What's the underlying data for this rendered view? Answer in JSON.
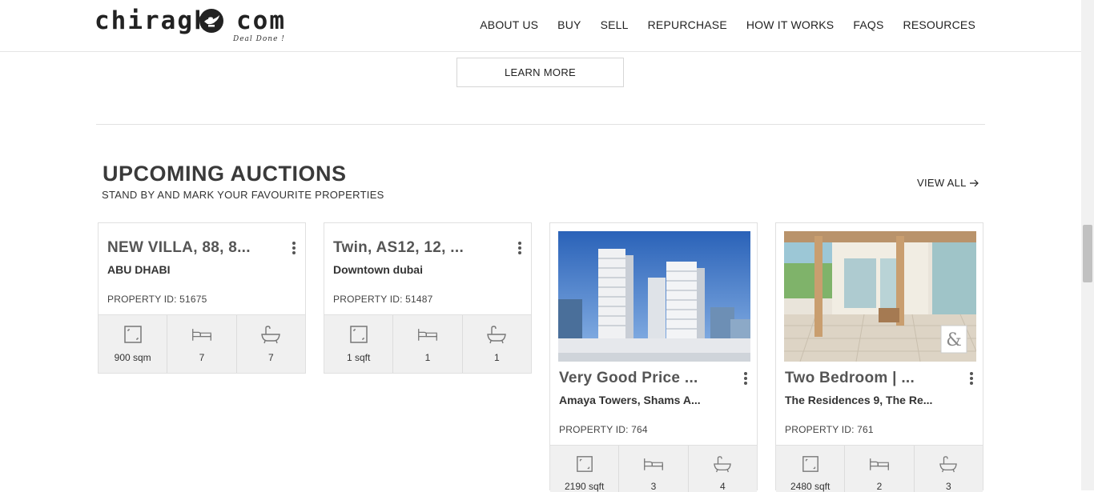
{
  "brand": {
    "left": "chiragh",
    "right": "com",
    "tagline": "Deal Done !"
  },
  "nav": [
    "ABOUT US",
    "BUY",
    "SELL",
    "REPURCHASE",
    "HOW IT WORKS",
    "FAQS",
    "RESOURCES"
  ],
  "learn_more": "LEARN MORE",
  "section": {
    "title": "UPCOMING AUCTIONS",
    "subtitle": "STAND BY AND MARK YOUR FAVOURITE PROPERTIES",
    "view_all": "VIEW ALL"
  },
  "cards": [
    {
      "title": "NEW VILLA, 88, 8...",
      "location": "ABU DHABI",
      "property_id": "PROPERTY ID: 51675",
      "area": "900 sqm",
      "beds": "7",
      "baths": "7"
    },
    {
      "title": "Twin, AS12, 12, ...",
      "location": "Downtown dubai",
      "property_id": "PROPERTY ID: 51487",
      "area": "1 sqft",
      "beds": "1",
      "baths": "1"
    },
    {
      "title": "Very Good Price ...",
      "location": "Amaya Towers, Shams A...",
      "property_id": "PROPERTY ID: 764",
      "area": "2190 sqft",
      "beds": "3",
      "baths": "4"
    },
    {
      "title": "Two Bedroom | ...",
      "location": "The Residences 9, The Re...",
      "property_id": "PROPERTY ID: 761",
      "area": "2480 sqft",
      "beds": "2",
      "baths": "3"
    }
  ]
}
